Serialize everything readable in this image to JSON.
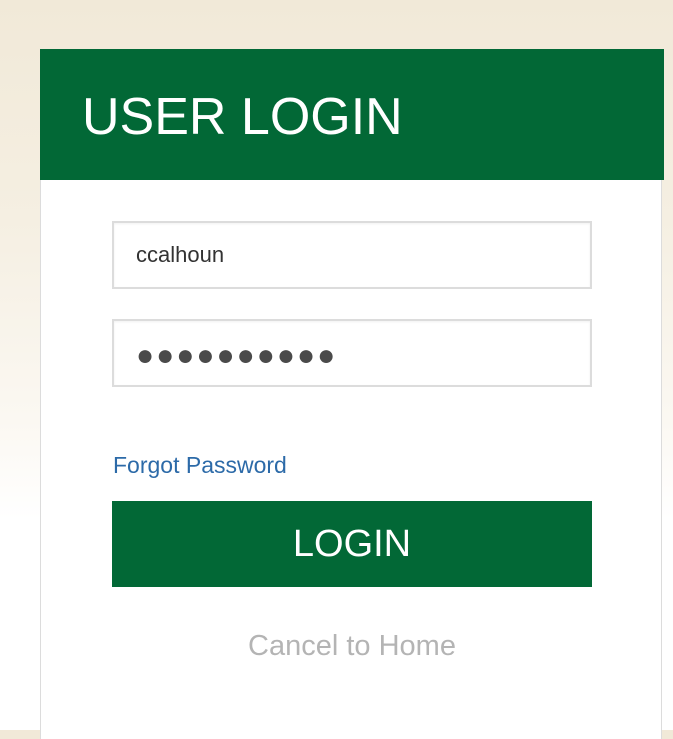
{
  "login": {
    "title": "USER LOGIN",
    "username": {
      "value": "ccalhoun"
    },
    "password": {
      "masked_value": "●●●●●●●●●●"
    },
    "forgot_password_label": "Forgot Password",
    "login_button_label": "LOGIN",
    "cancel_label": "Cancel to Home"
  },
  "colors": {
    "brand_green": "#026836",
    "link_blue": "#2c6aa8",
    "muted_gray": "#b4b4b4",
    "page_background": "#f1e9d8"
  }
}
